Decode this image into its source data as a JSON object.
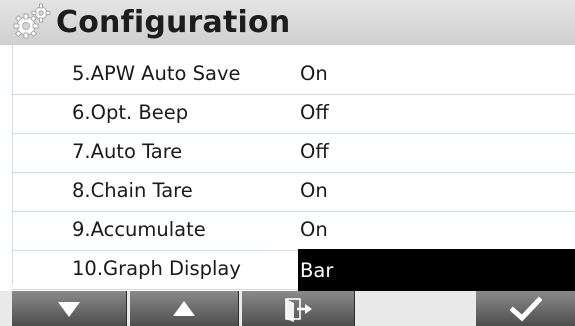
{
  "header": {
    "title": "Configuration",
    "icon": "gears-icon"
  },
  "settings": [
    {
      "label": "5.APW Auto Save",
      "value": "On"
    },
    {
      "label": "6.Opt. Beep",
      "value": "Off"
    },
    {
      "label": "7.Auto Tare",
      "value": "Off"
    },
    {
      "label": "8.Chain Tare",
      "value": "On"
    },
    {
      "label": "9.Accumulate",
      "value": "On"
    },
    {
      "label": "10.Graph Display",
      "value": "Bar",
      "selected": true
    }
  ],
  "footer": {
    "buttons": [
      {
        "icon": "down-arrow-icon"
      },
      {
        "icon": "up-arrow-icon"
      },
      {
        "icon": "exit-icon"
      },
      {
        "icon": "blank"
      },
      {
        "icon": "checkmark-icon"
      }
    ]
  },
  "colors": {
    "header_bg": "#d6d6d6",
    "row_divider": "#c9ddf1",
    "selected_bg": "#000000",
    "button_bg": "#6a6a6a"
  }
}
